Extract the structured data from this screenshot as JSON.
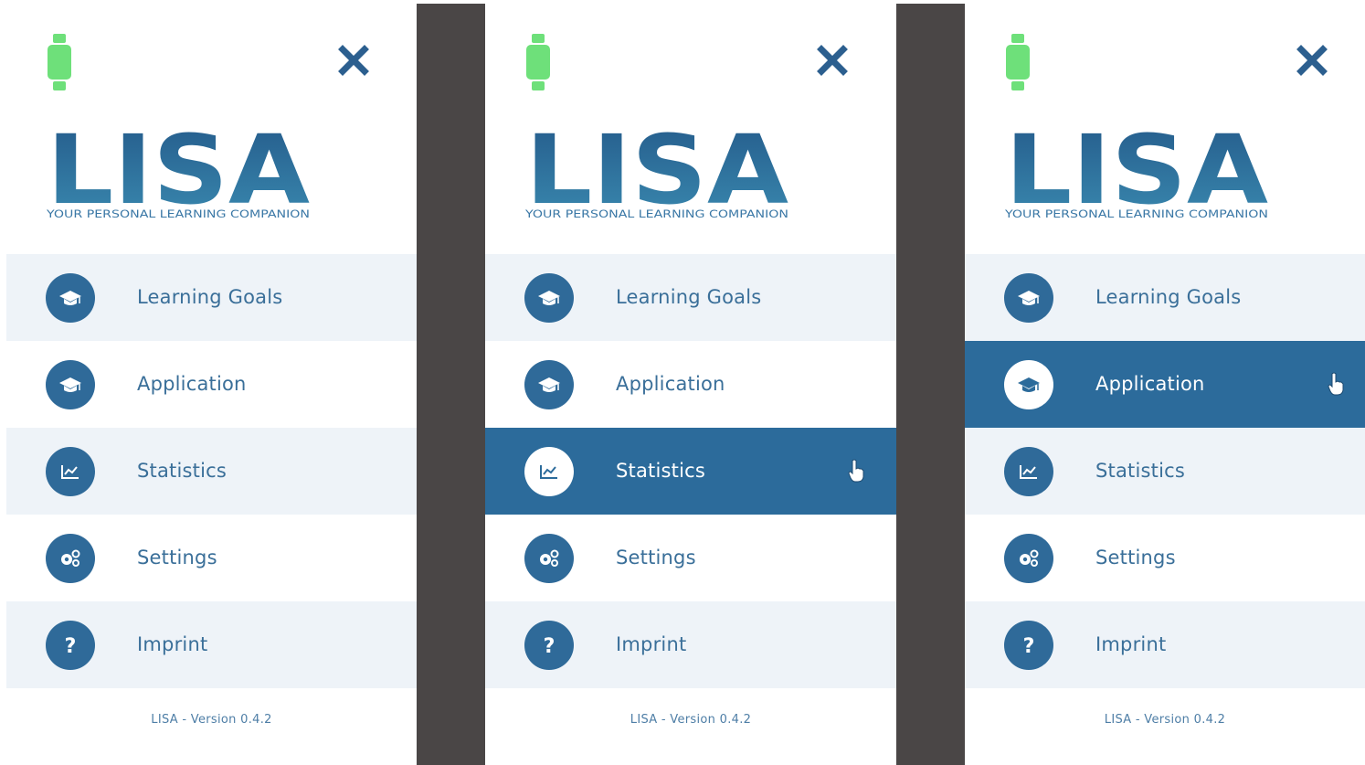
{
  "brand": {
    "name": "LISA",
    "tagline": "YOUR PERSONAL LEARNING COMPANION",
    "footer": "LISA  - Version 0.4.2"
  },
  "colors": {
    "primary": "#2c6b9b",
    "row_alt": "#eef3f8",
    "watch": "#6ee07a",
    "divider": "#4a4646"
  },
  "menu_items": [
    {
      "label": "Learning Goals",
      "icon": "graduation-cap-icon"
    },
    {
      "label": "Application",
      "icon": "graduation-cap-icon"
    },
    {
      "label": "Statistics",
      "icon": "chart-icon"
    },
    {
      "label": "Settings",
      "icon": "gears-icon"
    },
    {
      "label": "Imprint",
      "icon": "question-icon"
    }
  ],
  "panels": [
    {
      "active_item": "none"
    },
    {
      "active_item": "Statistics"
    },
    {
      "active_item": "Application"
    }
  ]
}
